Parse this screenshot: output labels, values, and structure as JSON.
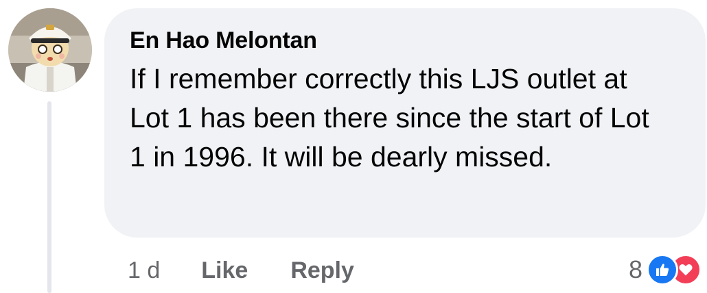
{
  "comment": {
    "author": "En Hao Melontan",
    "text": "If I remember correctly this LJS outlet at Lot 1 has been there since the start of Lot 1 in 1996. It will be dearly missed.",
    "avatar_icon": "profile-avatar-plush-captain"
  },
  "actions": {
    "timestamp": "1 d",
    "like_label": "Like",
    "reply_label": "Reply"
  },
  "reactions": {
    "count": "8",
    "icons": [
      "thumbs-up-icon",
      "heart-icon"
    ],
    "colors": {
      "like": "#1877f2",
      "love": "#f33e58"
    }
  }
}
